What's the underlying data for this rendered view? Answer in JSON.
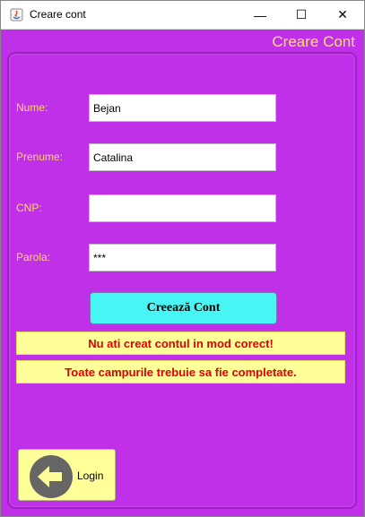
{
  "window": {
    "title": "Creare cont",
    "controls": {
      "minimize": "—",
      "maximize": "☐",
      "close": "✕"
    }
  },
  "header": {
    "title": "Creare Cont"
  },
  "form": {
    "nume": {
      "label": "Nume:",
      "value": "Bejan"
    },
    "prenume": {
      "label": "Prenume:",
      "value": "Catalina"
    },
    "cnp": {
      "label": "CNP:",
      "value": ""
    },
    "parola": {
      "label": "Parola:",
      "value": "***"
    },
    "submit_label": "Creează Cont"
  },
  "messages": [
    "Nu ati creat contul in mod corect!",
    "Toate campurile trebuie sa fie completate."
  ],
  "login_button": {
    "label": "Login",
    "icon": "arrow-left-icon"
  },
  "colors": {
    "background": "#bf30e8",
    "label": "#ffd866",
    "create_button": "#48f5f5",
    "message_bg": "#ffff99",
    "message_text": "#e00000"
  }
}
